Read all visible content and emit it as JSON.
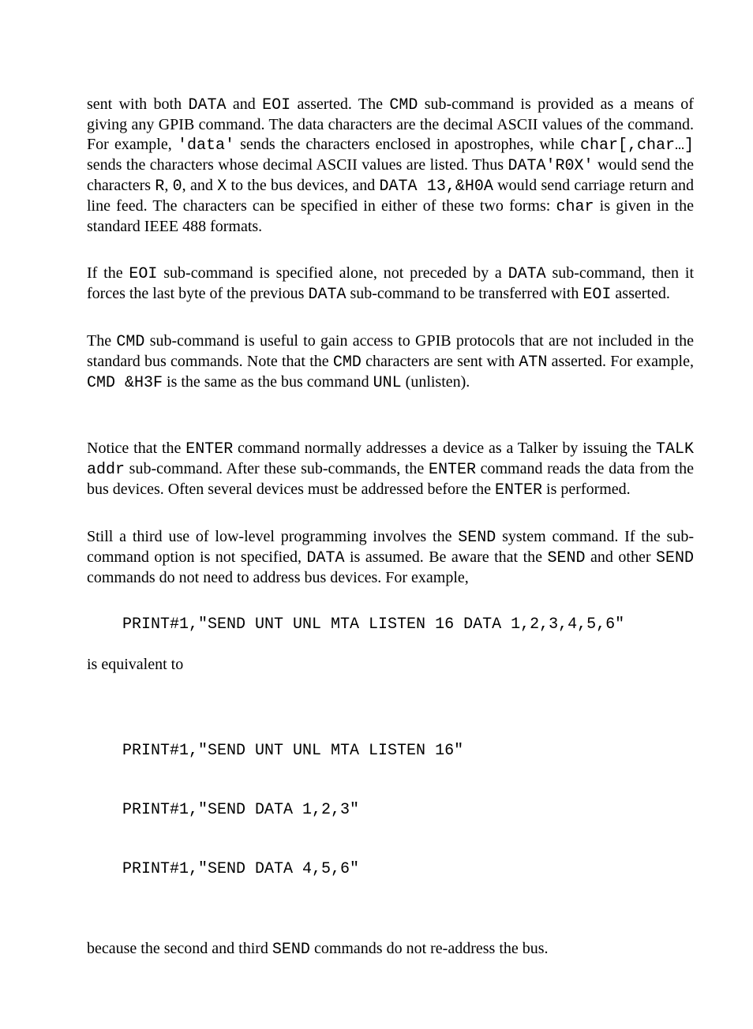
{
  "para1": {
    "pre1": "sent with both ",
    "c1": "DATA",
    "mid1": " and ",
    "c2": "EOI",
    "mid2": " asserted. The ",
    "c3": "CMD",
    "mid3": " sub-command is provided as a means of giving any GPIB command. The data characters are the decimal ASCII values of the command. For example, ",
    "c4": "'data'",
    "mid4": " sends the characters enclosed in apostrophes, while ",
    "c5": "char[,char…]",
    "mid5": " sends the characters whose decimal ASCII values are listed. Thus ",
    "c6": "DATA'R0X'",
    "mid6": " would send the characters ",
    "c7": "R",
    "mid7": ", ",
    "c8": "0",
    "mid8": ", and ",
    "c9": "X",
    "mid9": " to the bus devices, and ",
    "c10": "DATA 13,&H0A",
    "mid10": " would send carriage return and line feed. The characters can be specified in either of these two forms: ",
    "c11": "char",
    "mid11": " is given in the standard IEEE 488 formats."
  },
  "para2": {
    "pre1": "If the ",
    "c1": "EOI",
    "mid1": " sub-command is specified alone, not preceded by a ",
    "c2": "DATA",
    "mid2": " sub-command, then it forces the last byte of the previous ",
    "c3": "DATA",
    "mid3": " sub-command to be transferred with ",
    "c4": "EOI",
    "mid4": " asserted."
  },
  "para3": {
    "pre1": "The ",
    "c1": "CMD",
    "mid1": " sub-command is useful to gain access to GPIB protocols that are not included in the standard bus commands. Note that the ",
    "c2": "CMD",
    "mid2": " characters are sent with ",
    "c3": "ATN",
    "mid3": " asserted. For example, ",
    "c4": "CMD &H3F",
    "mid4": " is the same as the bus command ",
    "c5": "UNL",
    "mid5": " (unlisten)."
  },
  "para4": {
    "pre1": "Notice that the ",
    "c1": "ENTER",
    "mid1": " command normally addresses a device as a Talker by issuing the ",
    "c2": "TALK addr",
    "mid2": " sub-command. After these sub-commands, the ",
    "c3": "ENTER",
    "mid3": " command reads the data from the bus devices. Often several devices must be addressed before the ",
    "c4": "ENTER",
    "mid4": " is performed."
  },
  "para5": {
    "pre1": "Still a third use of low-level programming involves the ",
    "c1": "SEND",
    "mid1": " system command. If the sub-command option is not specified, ",
    "c2": "DATA",
    "mid2": " is assumed. Be aware that the ",
    "c3": "SEND",
    "mid3": " and other ",
    "c4": "SEND",
    "mid4": " commands do not need to address bus devices. For example,"
  },
  "code1": "PRINT#1,\"SEND UNT UNL MTA LISTEN 16 DATA 1,2,3,4,5,6\"",
  "between": "is equivalent to",
  "code2_l1": "PRINT#1,\"SEND UNT UNL MTA LISTEN 16\"",
  "code2_l2": "PRINT#1,\"SEND DATA 1,2,3\"",
  "code2_l3": "PRINT#1,\"SEND DATA 4,5,6\"",
  "para6": {
    "pre1": "because the second and third ",
    "c1": "SEND",
    "mid1": " commands do not re-address the bus."
  }
}
